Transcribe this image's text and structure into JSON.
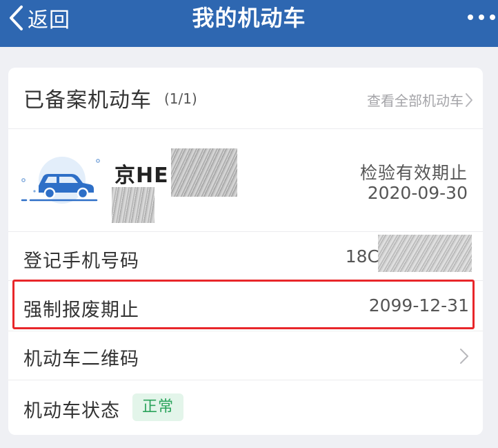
{
  "navbar": {
    "back_label": "返回",
    "title": "我的机动车",
    "more_icon": "more-dots-icon"
  },
  "card": {
    "header": {
      "title": "已备案机动车",
      "count": "(1/1)",
      "view_all_label": "查看全部机动车"
    },
    "vehicle": {
      "plate": "京HE",
      "inspection_label": "检验有效期止",
      "inspection_date": "2020-09-30"
    },
    "rows": {
      "phone": {
        "label": "登记手机号码",
        "value": "18C"
      },
      "scrap": {
        "label": "强制报废期止",
        "value": "2099-12-31"
      },
      "qrcode": {
        "label": "机动车二维码"
      },
      "status": {
        "label": "机动车状态",
        "badge": "正常"
      }
    }
  },
  "colors": {
    "navbar_bg": "#2e67b1",
    "page_bg": "#eff0f4",
    "highlight_border": "#e8262a",
    "status_badge_bg": "#e3f5ea",
    "status_badge_text": "#2aa35b",
    "car_blue": "#2e6fc7"
  }
}
